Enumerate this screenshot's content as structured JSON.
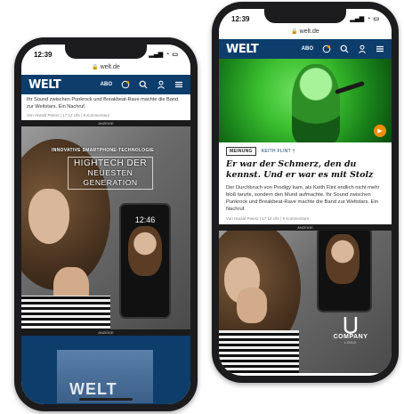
{
  "left_phone": {
    "status": {
      "time": "12:39",
      "signal_icon": "signal-icon",
      "wifi_icon": "wifi-icon",
      "battery_icon": "battery-icon"
    },
    "url": "welt.de",
    "navbar": {
      "logo": "WELT",
      "abo": "ABO",
      "colors": {
        "navbar": "#0d3d6b"
      }
    },
    "snippet": {
      "text": "Ihr Sound zwischen Punkrock und Breakbeat-Rave machte die Band zur Weltstars. Ein Nachruf.",
      "meta": "Von Harald Peters | 17:12 Uhr | 9 Kommentare"
    },
    "ad_label": "ANZEIGE",
    "ad": {
      "kicker": "INNOVATIVE SMARTPHONE-TECHNOLOGIE",
      "headline_1": "HIGHTECH DER",
      "headline_2": "NEUESTEN GENERATION",
      "clock": "12:46"
    },
    "ad_label_2": "ANZEIGE",
    "bottom_logo": "WELT"
  },
  "right_phone": {
    "status": {
      "time": "12:39"
    },
    "url": "welt.de",
    "navbar": {
      "logo": "WELT",
      "abo": "ABO"
    },
    "teaser": {
      "tag": "MEINUNG",
      "topic": "KEITH FLINT †",
      "title": "Er war der Schmerz, den du kennst. Und er war es mit Stolz",
      "text": "Der Durchbruch von Prodigy kam, als Keith Flint endlich nicht mehr bloß tanzte, sondern den Mund aufmachte. Ihr Sound zwischen Punkrock und Breakbeat-Rave machte die Band zur Weltstars. Ein Nachruf.",
      "meta": "Von Harald Peters | 17:12 Uhr | 9 Kommentare"
    },
    "ad_label": "ANZEIGE",
    "company": {
      "name": "COMPANY",
      "sub": "LOGO"
    }
  }
}
